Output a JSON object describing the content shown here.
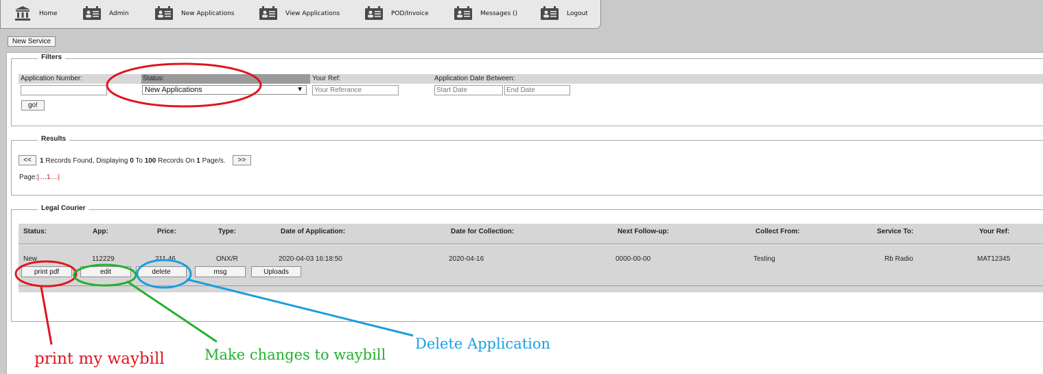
{
  "nav": [
    {
      "label": "Home",
      "icon": "bank-icon"
    },
    {
      "label": "Admin",
      "icon": "id-card-icon"
    },
    {
      "label": "New Applications",
      "icon": "id-card-icon"
    },
    {
      "label": "View Applications",
      "icon": "id-card-icon"
    },
    {
      "label": "POD/Invoice",
      "icon": "id-card-icon"
    },
    {
      "label": "Messages ()",
      "icon": "id-card-icon"
    },
    {
      "label": "Logout",
      "icon": "id-card-icon"
    }
  ],
  "new_service_label": "New Service",
  "filters": {
    "legend": "Filters",
    "app_number_label": "Application Number:",
    "status_label": "Status:",
    "status_value": "New Applications",
    "your_ref_label": "Your Ref:",
    "your_ref_placeholder": "Your Referance",
    "date_between_label": "Application Date Between:",
    "start_date_placeholder": "Start Date",
    "end_date_placeholder": "End Date",
    "go_label": "go!"
  },
  "results": {
    "legend": "Results",
    "prev_label": "<<",
    "next_label": ">>",
    "count": "1",
    "text1": " Records Found, Displaying ",
    "from": "0",
    "text2": " To ",
    "to": "100",
    "text3": " Records On ",
    "pages": "1",
    "text4": " Page/s.",
    "page_label": "Page:",
    "page_links": "|....1....|"
  },
  "legal": {
    "legend": "Legal Courier",
    "columns": [
      "Status:",
      "App:",
      "Price:",
      "Type:",
      "Date of Application:",
      "Date for Collection:",
      "Next Follow-up:",
      "Collect From:",
      "Service To:",
      "Your Ref:"
    ],
    "row": [
      "New",
      "112229",
      "211.46",
      "ONX/R",
      "2020-04-03 16:18:50",
      "2020-04-16",
      "0000-00-00",
      "Testing",
      "Rb Radio",
      "MAT12345"
    ],
    "actions": [
      "print pdf",
      "edit",
      "delete",
      "msg",
      "Uploads"
    ]
  },
  "annotations": {
    "print": "print my waybill",
    "edit": "Make changes to waybill",
    "delete": "Delete Application"
  },
  "colors": {
    "red": "#e0141e",
    "green": "#22b02e",
    "blue": "#1a9ee0"
  }
}
